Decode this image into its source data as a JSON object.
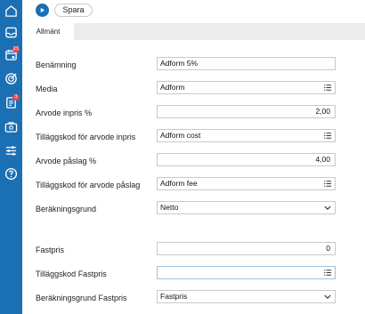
{
  "toolbar": {
    "save_label": "Spara"
  },
  "tabs": [
    {
      "label": "Allmänt"
    }
  ],
  "sidebar": {
    "items": [
      {
        "icon": "home-icon"
      },
      {
        "icon": "inbox-icon"
      },
      {
        "icon": "calendar-icon",
        "badge": "23"
      },
      {
        "icon": "target-icon"
      },
      {
        "icon": "document-icon",
        "badge": "3"
      },
      {
        "icon": "briefcase-icon"
      },
      {
        "icon": "sliders-icon"
      },
      {
        "icon": "help-icon"
      }
    ]
  },
  "form": {
    "name": {
      "label": "Benämning",
      "value": "Adform 5%"
    },
    "media": {
      "label": "Media",
      "value": "Adform"
    },
    "fee_cost": {
      "label": "Arvode inpris %",
      "value": "2,00"
    },
    "addon_fee_cost": {
      "label": "Tilläggskod för arvode inpris",
      "value": "Adform cost"
    },
    "fee_markup": {
      "label": "Arvode påslag %",
      "value": "4,00"
    },
    "addon_fee_markup": {
      "label": "Tilläggskod för arvode påslag",
      "value": "Adform fee"
    },
    "calc_basis": {
      "label": "Beräkningsgrund",
      "value": "Netto"
    },
    "fixed_price": {
      "label": "Fastpris",
      "value": "0"
    },
    "addon_fixed": {
      "label": "Tilläggskod Fastpris",
      "value": ""
    },
    "calc_basis_fixed": {
      "label": "Beräkningsgrund Fastpris",
      "value": "Fastpris"
    }
  },
  "colors": {
    "brand": "#1b6fb3",
    "badge": "#e84a4a",
    "tabbar": "#ececec",
    "field_border": "#c9c9c9"
  }
}
